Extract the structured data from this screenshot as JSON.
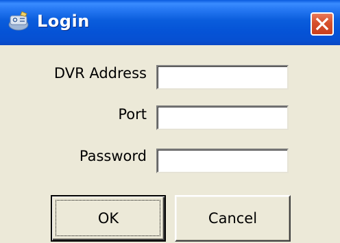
{
  "window": {
    "title": "Login",
    "app_icon": "dvr-app-icon",
    "close_icon": "close-x-icon",
    "titlebar_color": "#0a5ddc",
    "close_color": "#d6502c",
    "background_color": "#ece9d8"
  },
  "form": {
    "fields": [
      {
        "label": "DVR Address",
        "value": ""
      },
      {
        "label": "Port",
        "value": ""
      },
      {
        "label": "Password",
        "value": ""
      }
    ]
  },
  "buttons": {
    "ok_label": "OK",
    "cancel_label": "Cancel"
  }
}
